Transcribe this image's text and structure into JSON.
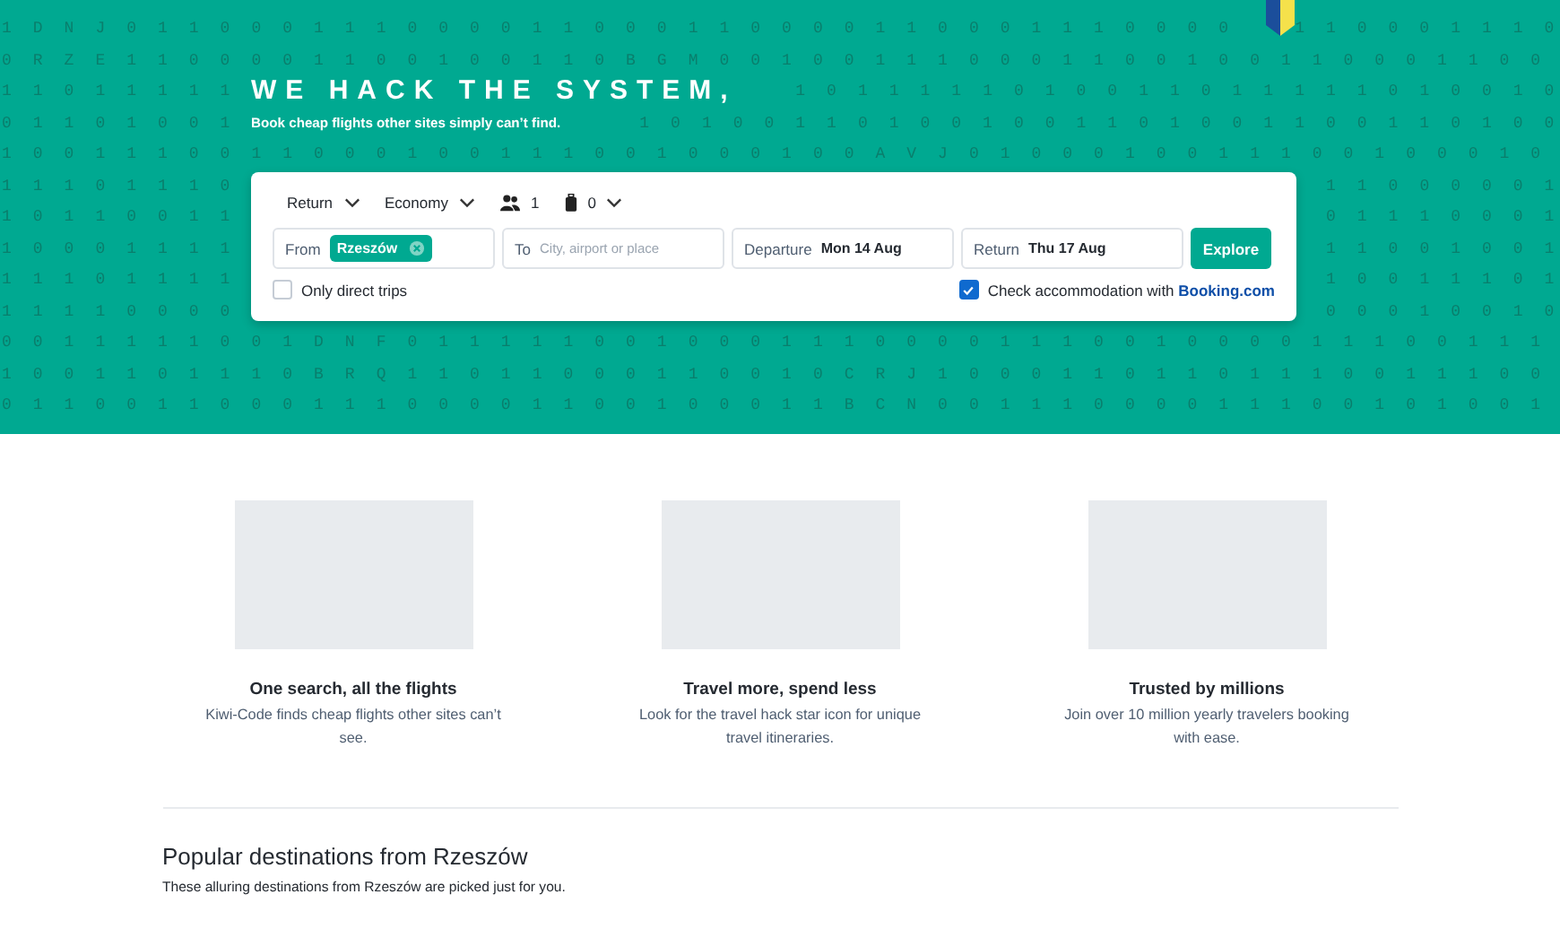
{
  "hero": {
    "pattern_rows": [
      {
        "left": "1 D N J 0 1 1 0 0 0 1 1 1 0 0 0 0 1 1 0 0 0 1 1 0 0 0 0 1 1 0 0 0 1 1 1 0 0 0 0",
        "right": "1 1 0 0 0 1 1 1 0"
      },
      {
        "left": "0 R Z E 1 1 0 0 0 0 1 1 0 0 1 0 0 1 1 0 B G M 0 0 1 0 0 1 1 1 0 0 0 1 1 0 0 1 0 0 1 1 0 0 0 1 1 0 0"
      },
      {
        "left": "1 1 0 1 1 1 1 1",
        "right": "1 0 1 1 1 1 1 0 1 0 0 1 1 0 1 1 1 1 1 0 1 0 0 1 0"
      },
      {
        "left": "0 1 1 0 1 0 0 1",
        "right": "1 0 1 0 0 1 1 0 1 0 0 1 0 0 1 1 0 1 0 0 1 1 0 0 1 1 0 1 0 0"
      },
      {
        "left": "1 0 0 1 1 1 0 0 1 1 0 0 0 1 0 0 1 1 1 0 0 1 0 0 0 1 0 0 A V J 0 1 0 0 0 1 0 0 1 1 1 0 0 1 0 0 0 1 0"
      },
      {
        "left": "1 1 1 0 1 1 1 0",
        "right": "1 1 0 0 0 0 0 1"
      },
      {
        "left": "1 0 1 1 0 0 1 1",
        "right": "0 1 1 1 0 0 0 1"
      },
      {
        "left": "1 0 0 0 1 1 1 1",
        "right": "1 1 0 0 1 0 0 1"
      },
      {
        "left": "1 1 1 0 1 1 1 1",
        "right": "1 0 0 1 1 1 0 1"
      },
      {
        "left": "1 1 1 1 0 0 0 0",
        "right": "0 0 0 1 0 0 1 0"
      },
      {
        "left": "0 0 1 1 1 1 1 0 0 1 D N F 0 1 1 1 1 1 0 0 1 0 0 0 1 1 1 0 0 0 0 1 1 1 0 0 1 0 0 0 0 1 1 1 0 0 1 1 1"
      },
      {
        "left": "1 0 0 1 1 0 1 1 1 0 B R Q 1 1 0 1 1 0 0 0 1 1 0 0 1 0 C R J 1 0 0 0 1 1 0 1 1 0 1 1 1 0 0 1 1 1 0 0"
      },
      {
        "left": "0 1 1 0 0 1 1 0 0 0 1 1 1 0 0 0 0 1 1 0 0 1 0 0 0 1 1 B C N 0 0 1 1 1 0 0 0 0 1 1 1 0 0 1 0 1 0 0 1"
      }
    ],
    "title": "WE HACK THE SYSTEM,",
    "subtitle": "Book cheap flights other sites simply can’t find."
  },
  "search": {
    "trip_type": "Return",
    "cabin": "Economy",
    "passengers": "1",
    "bags": "0",
    "from": {
      "label": "From",
      "chips": [
        "Rzeszów"
      ]
    },
    "to": {
      "label": "To",
      "placeholder": "City, airport or place"
    },
    "departure": {
      "label": "Departure",
      "value": "Mon 14 Aug"
    },
    "return": {
      "label": "Return",
      "value": "Thu 17 Aug"
    },
    "explore_button": "Explore",
    "options": [
      {
        "label": "Only direct trips",
        "checked": false
      },
      {
        "label": "Check accommodation with",
        "link": "Booking.com",
        "checked": true
      }
    ]
  },
  "features": [
    {
      "title": "One search, all the flights",
      "text": "Kiwi-Code finds cheap flights other sites can’t see."
    },
    {
      "title": "Travel more, spend less",
      "text": "Look for the travel hack star icon for unique travel itineraries."
    },
    {
      "title": "Trusted by millions",
      "text": "Join over 10 million yearly travelers booking with ease."
    }
  ],
  "popular": {
    "title": "Popular destinations from Rzeszów",
    "subtitle": "These alluring destinations from Rzeszów are picked just for you."
  }
}
